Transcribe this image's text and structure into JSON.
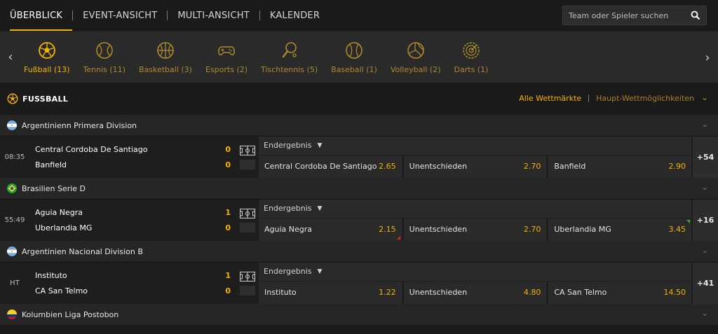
{
  "nav": {
    "tabs": [
      {
        "label": "ÜBERBLICK"
      },
      {
        "label": "EVENT-ANSICHT"
      },
      {
        "label": "MULTI-ANSICHT"
      },
      {
        "label": "KALENDER"
      }
    ],
    "search_placeholder": "Team oder Spieler suchen"
  },
  "sports": [
    {
      "label": "Fußball (13)",
      "icon": "football-icon"
    },
    {
      "label": "Tennis (11)",
      "icon": "tennis-icon"
    },
    {
      "label": "Basketball (3)",
      "icon": "basketball-icon"
    },
    {
      "label": "Esports (2)",
      "icon": "gamepad-icon"
    },
    {
      "label": "Tischtennis (5)",
      "icon": "table-tennis-icon"
    },
    {
      "label": "Baseball (1)",
      "icon": "baseball-icon"
    },
    {
      "label": "Volleyball (2)",
      "icon": "volleyball-icon"
    },
    {
      "label": "Darts (1)",
      "icon": "darts-icon"
    }
  ],
  "section": {
    "title": "FUSSBALL",
    "market_all": "Alle Wettmärkte",
    "market_main": "Haupt-Wettmöglichkeiten"
  },
  "leagues": [
    {
      "name": "Argentinienn Primera Division",
      "flag": "argentina",
      "match": {
        "time": "08:35",
        "home": "Central Cordoba De Santiago",
        "away": "Banfield",
        "home_score": "0",
        "away_score": "0",
        "market": "Endergebnis",
        "odds": [
          {
            "name": "Central Cordoba De Santiago",
            "value": "2.65"
          },
          {
            "name": "Unentschieden",
            "value": "2.70"
          },
          {
            "name": "Banfield",
            "value": "2.90"
          }
        ],
        "more": "+54"
      }
    },
    {
      "name": "Brasilien Serie D",
      "flag": "brazil",
      "match": {
        "time": "55:49",
        "home": "Aguia Negra",
        "away": "Uberlandia MG",
        "home_score": "1",
        "away_score": "0",
        "market": "Endergebnis",
        "odds": [
          {
            "name": "Aguia Negra",
            "value": "2.15"
          },
          {
            "name": "Unentschieden",
            "value": "2.70"
          },
          {
            "name": "Uberlandia MG",
            "value": "3.45"
          }
        ],
        "more": "+16"
      }
    },
    {
      "name": "Argentinien Nacional Division B",
      "flag": "argentina",
      "match": {
        "time": "HT",
        "home": "Instituto",
        "away": "CA San Telmo",
        "home_score": "1",
        "away_score": "0",
        "market": "Endergebnis",
        "odds": [
          {
            "name": "Instituto",
            "value": "1.22"
          },
          {
            "name": "Unentschieden",
            "value": "4.80"
          },
          {
            "name": "CA San Telmo",
            "value": "14.50"
          }
        ],
        "more": "+41"
      }
    },
    {
      "name": "Kolumbien Liga Postobon",
      "flag": "colombia"
    }
  ],
  "colors": {
    "accent": "#f5b400",
    "odds_down": "#d9271d",
    "odds_up": "#2fb33d"
  }
}
